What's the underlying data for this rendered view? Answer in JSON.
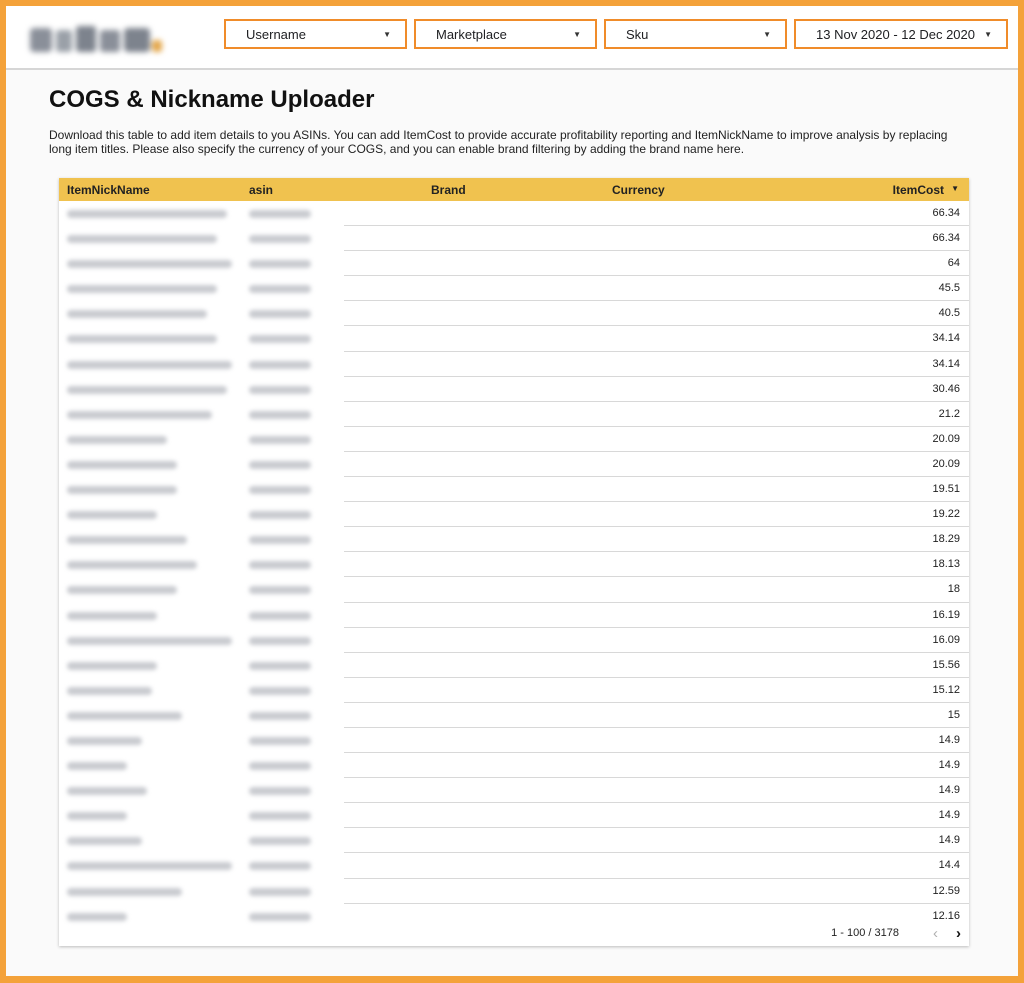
{
  "filters": {
    "username": "Username",
    "marketplace": "Marketplace",
    "sku": "Sku",
    "date_range": "13 Nov 2020 - 12 Dec 2020"
  },
  "page": {
    "title": "COGS & Nickname Uploader",
    "description": "Download this table to add item details to you ASINs. You can add ItemCost to provide accurate profitability reporting and ItemNickName to improve analysis by replacing long item titles. Please also specify the currency of your COGS, and you can enable brand filtering by adding the brand name here."
  },
  "table": {
    "columns": [
      "ItemNickName",
      "asin",
      "Brand",
      "Currency",
      "ItemCost"
    ],
    "sort_icon": "sort-desc-icon",
    "item_costs": [
      "66.34",
      "66.34",
      "64",
      "45.5",
      "40.5",
      "34.14",
      "34.14",
      "30.46",
      "21.2",
      "20.09",
      "20.09",
      "19.51",
      "19.22",
      "18.29",
      "18.13",
      "18",
      "16.19",
      "16.09",
      "15.56",
      "15.12",
      "15",
      "14.9",
      "14.9",
      "14.9",
      "14.9",
      "14.9",
      "14.4",
      "12.59",
      "12.16"
    ],
    "pagination": "1 - 100 / 3178"
  },
  "colors": {
    "frame": "#f4a23a",
    "dropdown_border": "#f08c2a",
    "header_bg": "#f0c24f"
  }
}
